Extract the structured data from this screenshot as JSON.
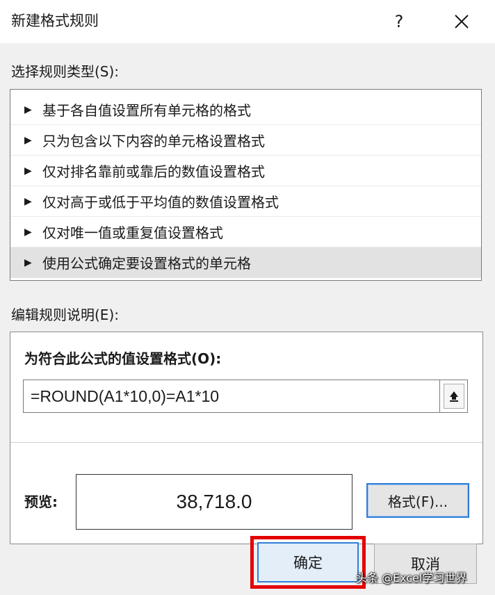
{
  "dialog": {
    "title": "新建格式规则",
    "help_label": "?"
  },
  "rule_type": {
    "label": "选择规则类型(S):",
    "items": [
      {
        "label": "基于各自值设置所有单元格的格式"
      },
      {
        "label": "只为包含以下内容的单元格设置格式"
      },
      {
        "label": "仅对排名靠前或靠后的数值设置格式"
      },
      {
        "label": "仅对高于或低于平均值的数值设置格式"
      },
      {
        "label": "仅对唯一值或重复值设置格式"
      },
      {
        "label": "使用公式确定要设置格式的单元格",
        "selected": true
      }
    ],
    "arrow_glyph": "▶"
  },
  "rule_desc": {
    "label": "编辑规则说明(E):",
    "formula_heading": "为符合此公式的值设置格式(O):",
    "formula_value": "=ROUND(A1*10,0)=A1*10",
    "preview_label": "预览:",
    "preview_value": "38,718.0",
    "format_button": "格式(F)..."
  },
  "buttons": {
    "ok": "确定",
    "cancel": "取消"
  },
  "watermark": "头条 @Excel学习世界",
  "icons": {
    "close": "close-icon",
    "collapse": "collapse-dialog-icon",
    "arrow": "triangle-right-icon"
  },
  "colors": {
    "accent_border": "#2f7fd8",
    "highlight_frame": "#e30000",
    "selected_row": "#e2e2e2"
  }
}
